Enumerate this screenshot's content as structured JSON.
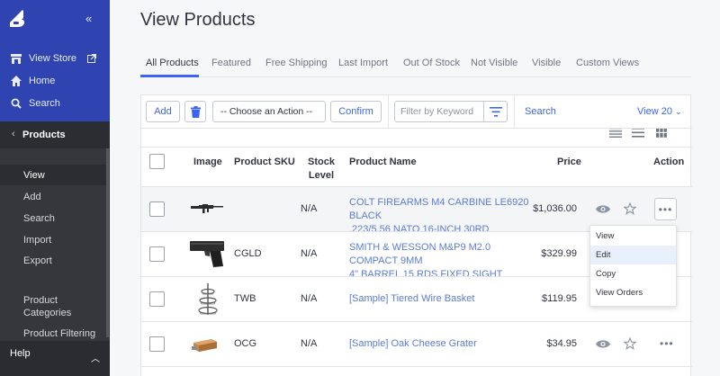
{
  "sidebar": {
    "links": [
      {
        "label": "View Store",
        "icon": "store-icon"
      },
      {
        "label": "Home",
        "icon": "home-icon"
      },
      {
        "label": "Search",
        "icon": "search-icon"
      }
    ],
    "section": "Products",
    "items": [
      "View",
      "Add",
      "Search",
      "Import",
      "Export"
    ],
    "categories_line1": "Product",
    "categories_line2": "Categories",
    "filtering": "Product Filtering",
    "help": "Help"
  },
  "page": {
    "title": "View Products"
  },
  "tabs": [
    "All Products",
    "Featured",
    "Free Shipping",
    "Last Import",
    "Out Of Stock",
    "Not Visible",
    "Visible",
    "Custom Views"
  ],
  "toolbar": {
    "add": "Add",
    "action_select": "-- Choose an Action --",
    "confirm": "Confirm",
    "filter_placeholder": "Filter by Keyword",
    "search": "Search",
    "view_count": "View 20"
  },
  "table": {
    "headers": {
      "image": "Image",
      "sku": "Product SKU",
      "stock1": "Stock",
      "stock2": "Level",
      "name": "Product Name",
      "price": "Price",
      "action": "Action"
    },
    "rows": [
      {
        "sku": "",
        "stock": "N/A",
        "name1": "COLT FIREARMS M4 CARBINE LE6920 BLACK",
        "name2": ".223/5.56 NATO 16-INCH 30RD",
        "price": "$1,036.00",
        "image": "rifle"
      },
      {
        "sku": "CGLD",
        "stock": "N/A",
        "name1": "SMITH & WESSON M&P9 M2.0 COMPACT 9MM",
        "name2": "4\" BARREL 15 RDS FIXED SIGHT",
        "price": "$329.99",
        "image": "pistol"
      },
      {
        "sku": "TWB",
        "stock": "N/A",
        "name1": "[Sample] Tiered Wire Basket",
        "name2": "",
        "price": "$119.95",
        "image": "wire-basket"
      },
      {
        "sku": "OCG",
        "stock": "N/A",
        "name1": "[Sample] Oak Cheese Grater",
        "name2": "",
        "price": "$34.95",
        "image": "cheese-grater"
      }
    ]
  },
  "action_menu": [
    "View",
    "Edit",
    "Copy",
    "View Orders"
  ],
  "colors": {
    "accent": "#3c64f4",
    "sidebar_top": "#2f44b0",
    "sidebar": "#35373d",
    "link": "#5b7cd6"
  }
}
